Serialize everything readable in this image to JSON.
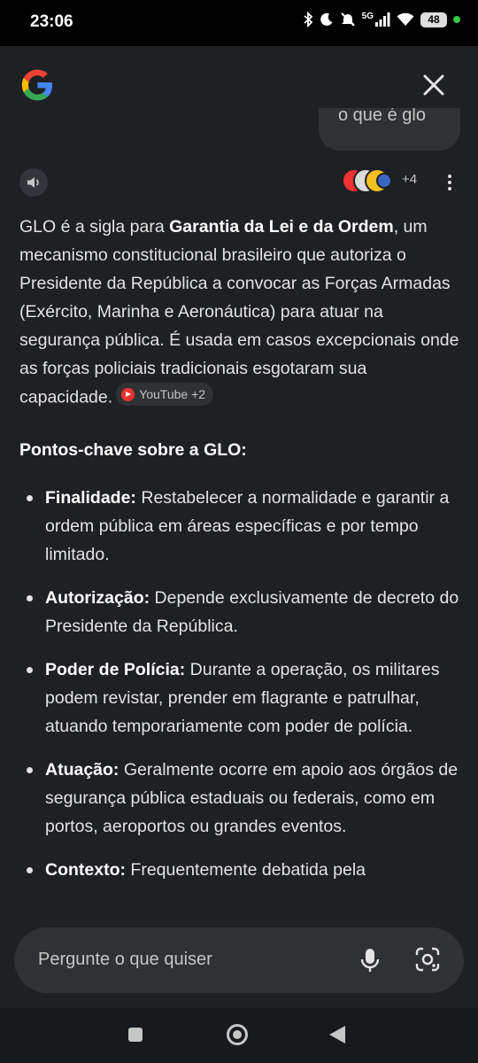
{
  "status_bar": {
    "time": "23:06",
    "network": "5G",
    "battery": "48",
    "icons": [
      "bluetooth-icon",
      "moon-icon",
      "mute-icon",
      "signal-icon",
      "wifi-icon",
      "battery-icon"
    ]
  },
  "header": {
    "logo": "google-g-logo",
    "close_icon": "close-icon"
  },
  "user_query": {
    "text": "o que é glo"
  },
  "toolbar": {
    "speaker_icon": "speaker-icon",
    "sources_count": "+4",
    "more_icon": "more-vert-icon"
  },
  "answer": {
    "intro_pre": "GLO é a sigla para ",
    "intro_bold": "Garantia da Lei e da Ordem",
    "intro_post": ", um mecanismo constitucional brasileiro que autoriza o Presidente da República a convocar as Forças Armadas (Exército, Marinha e Aeronáutica) para atuar na segurança pública. É usada em casos excepcionais onde as forças policiais tradicionais esgotaram sua capacidade.",
    "source_chip": "YouTube +2",
    "subheading": "Pontos-chave sobre a GLO:",
    "points": [
      {
        "label": "Finalidade:",
        "text": " Restabelecer a normalidade e garantir a ordem pública em áreas específicas e por tempo limitado."
      },
      {
        "label": "Autorização:",
        "text": " Depende exclusivamente de decreto do Presidente da República."
      },
      {
        "label": "Poder de Polícia:",
        "text": " Durante a operação, os militares podem revistar, prender em flagrante e patrulhar, atuando temporariamente com poder de polícia."
      },
      {
        "label": "Atuação:",
        "text": " Geralmente ocorre em apoio aos órgãos de segurança pública estaduais ou federais, como em portos, aeroportos ou grandes eventos."
      },
      {
        "label": "Contexto:",
        "text": " Frequentemente debatida pela"
      }
    ]
  },
  "input": {
    "placeholder": "Pergunte o que quiser",
    "mic_icon": "mic-icon",
    "lens_icon": "google-lens-icon"
  },
  "nav": {
    "recents_icon": "recents-square-icon",
    "home_icon": "home-circle-icon",
    "back_icon": "back-triangle-icon"
  },
  "colors": {
    "background": "#1f2023",
    "surface": "#303134",
    "text": "#e3e3e3",
    "youtube_red": "#ee3333"
  }
}
